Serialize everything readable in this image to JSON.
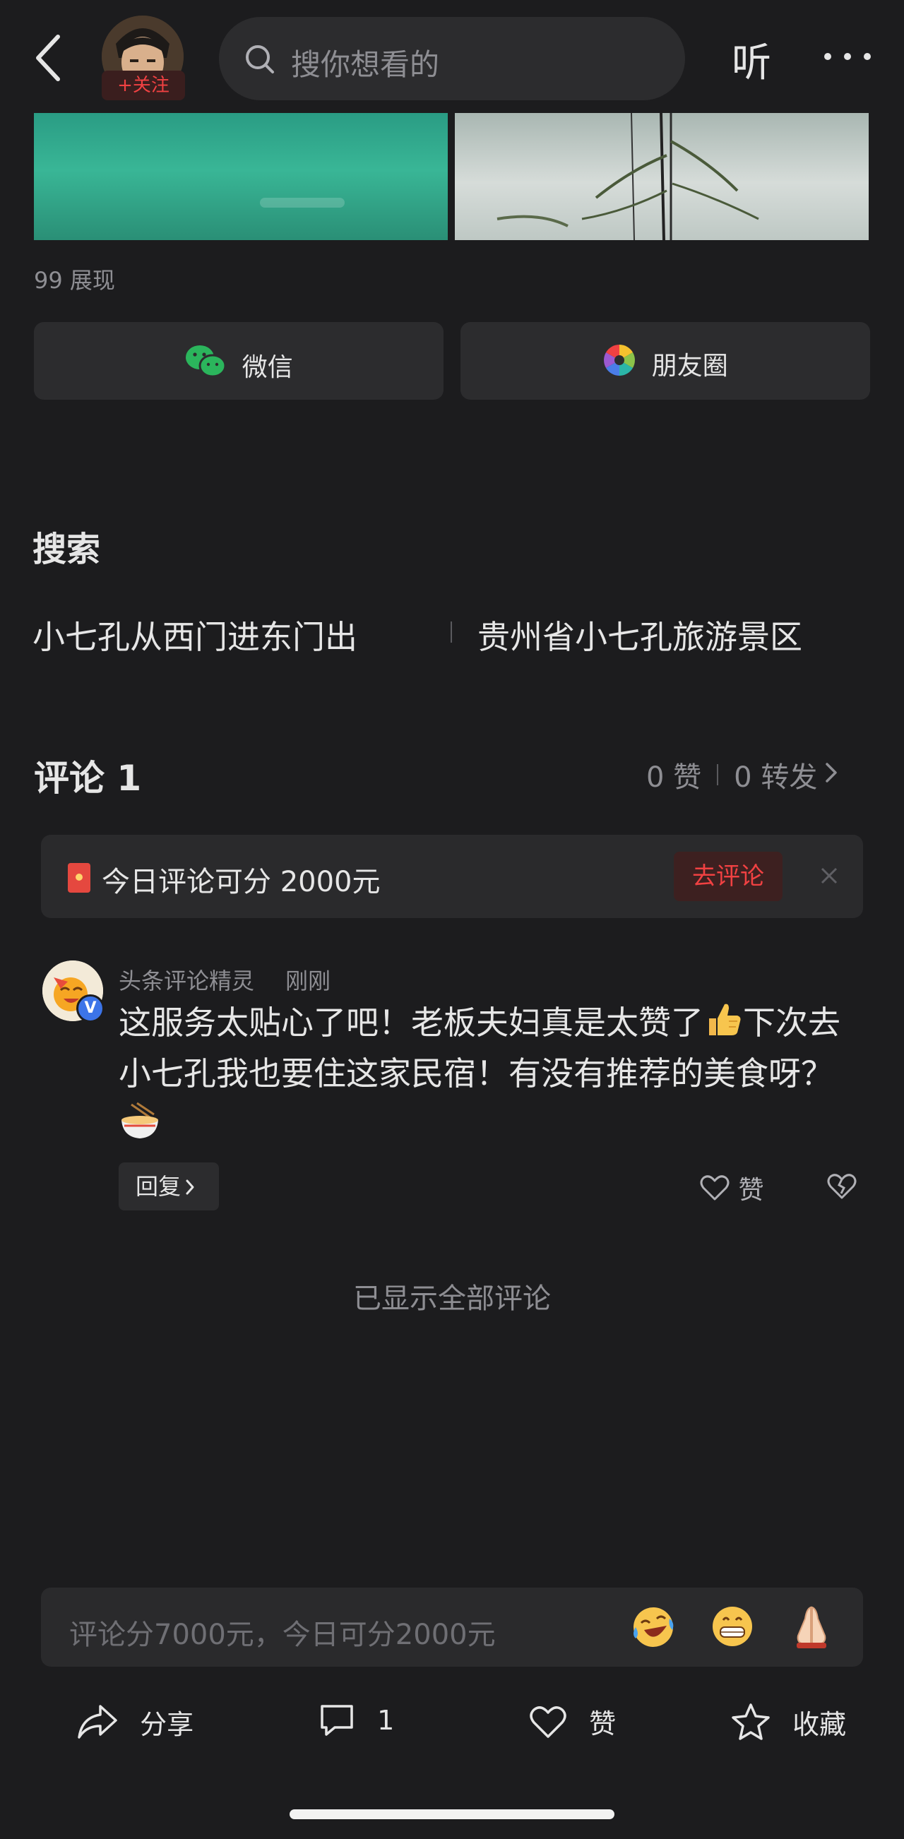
{
  "header": {
    "follow_label": "+关注",
    "search_placeholder": "搜你想看的",
    "listen_label": "听"
  },
  "post": {
    "views": "99 展现"
  },
  "share_targets": [
    {
      "label": "微信",
      "icon": "wechat-icon",
      "color": "#2bb55c"
    },
    {
      "label": "朋友圈",
      "icon": "moments-icon"
    }
  ],
  "search_section": {
    "title": "搜索",
    "suggestions": [
      "小七孔从西门进东门出",
      "贵州省小七孔旅游景区"
    ]
  },
  "comments": {
    "title": "评论 1",
    "likes": "0 赞",
    "reposts": "0 转发",
    "promo": {
      "text": "今日评论可分 2000元",
      "button": "去评论"
    },
    "items": [
      {
        "author": "头条评论精灵",
        "time": "刚刚",
        "text_1": "这服务太贴心了吧！老板夫妇真是太赞了",
        "text_2": "下次去小七孔我也要住这家民宿！有没有推荐的美食呀？",
        "reply_label": "回复",
        "like_label": "赞",
        "verified_badge": "V"
      }
    ],
    "all_shown": "已显示全部评论"
  },
  "composer": {
    "placeholder": "评论分7000元，今日可分2000元",
    "quick_emojis": [
      "laughing-crying-emoji",
      "grinning-emoji",
      "praying-hands-emoji"
    ]
  },
  "bottom_bar": {
    "share": "分享",
    "comment_count": "1",
    "like": "赞",
    "favorite": "收藏"
  },
  "colors": {
    "background": "#1c1c1e",
    "accent_red": "#f04142",
    "card": "#2c2c2e"
  }
}
